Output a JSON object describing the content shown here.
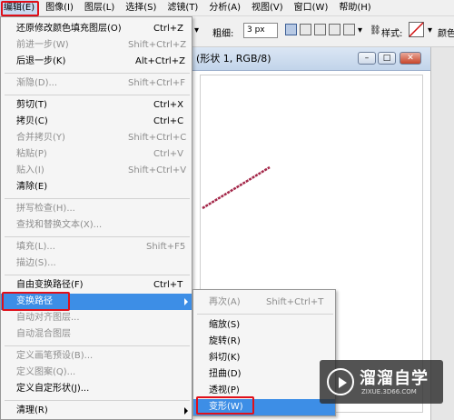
{
  "menubar": {
    "items": [
      "编辑(E)",
      "图像(I)",
      "图层(L)",
      "选择(S)",
      "滤镜(T)",
      "分析(A)",
      "视图(V)",
      "窗口(W)",
      "帮助(H)"
    ]
  },
  "options_bar": {
    "weight_label": "粗细:",
    "weight_value": "3 px",
    "style_label": "样式:",
    "color_label": "颜色:"
  },
  "document": {
    "title": "(形状 1, RGB/8)"
  },
  "edit_menu": {
    "items": [
      {
        "label": "还原修改颜色填充图层(O)",
        "shortcut": "Ctrl+Z",
        "disabled": false
      },
      {
        "label": "前进一步(W)",
        "shortcut": "Shift+Ctrl+Z",
        "disabled": true
      },
      {
        "label": "后退一步(K)",
        "shortcut": "Alt+Ctrl+Z",
        "disabled": false
      },
      {
        "label": "渐隐(D)...",
        "shortcut": "Shift+Ctrl+F",
        "disabled": true
      },
      {
        "label": "剪切(T)",
        "shortcut": "Ctrl+X",
        "disabled": false
      },
      {
        "label": "拷贝(C)",
        "shortcut": "Ctrl+C",
        "disabled": false
      },
      {
        "label": "合并拷贝(Y)",
        "shortcut": "Shift+Ctrl+C",
        "disabled": true
      },
      {
        "label": "粘贴(P)",
        "shortcut": "Ctrl+V",
        "disabled": true
      },
      {
        "label": "贴入(I)",
        "shortcut": "Shift+Ctrl+V",
        "disabled": true
      },
      {
        "label": "清除(E)",
        "shortcut": "",
        "disabled": false
      },
      {
        "label": "拼写检查(H)...",
        "shortcut": "",
        "disabled": true
      },
      {
        "label": "查找和替换文本(X)...",
        "shortcut": "",
        "disabled": true
      },
      {
        "label": "填充(L)...",
        "shortcut": "Shift+F5",
        "disabled": true
      },
      {
        "label": "描边(S)...",
        "shortcut": "",
        "disabled": true
      },
      {
        "label": "自由变换路径(F)",
        "shortcut": "Ctrl+T",
        "disabled": false
      },
      {
        "label": "变换路径",
        "shortcut": "",
        "disabled": false
      },
      {
        "label": "自动对齐图层...",
        "shortcut": "",
        "disabled": true
      },
      {
        "label": "自动混合图层",
        "shortcut": "",
        "disabled": true
      },
      {
        "label": "定义画笔预设(B)...",
        "shortcut": "",
        "disabled": true
      },
      {
        "label": "定义图案(Q)...",
        "shortcut": "",
        "disabled": true
      },
      {
        "label": "定义自定形状(J)...",
        "shortcut": "",
        "disabled": false
      },
      {
        "label": "清理(R)",
        "shortcut": "",
        "disabled": false
      }
    ]
  },
  "transform_submenu": {
    "items": [
      {
        "label": "再次(A)",
        "shortcut": "Shift+Ctrl+T",
        "disabled": true
      },
      {
        "label": "缩放(S)",
        "shortcut": "",
        "disabled": false
      },
      {
        "label": "旋转(R)",
        "shortcut": "",
        "disabled": false
      },
      {
        "label": "斜切(K)",
        "shortcut": "",
        "disabled": false
      },
      {
        "label": "扭曲(D)",
        "shortcut": "",
        "disabled": false
      },
      {
        "label": "透视(P)",
        "shortcut": "",
        "disabled": false
      },
      {
        "label": "变形(W)",
        "shortcut": "",
        "disabled": false
      }
    ]
  },
  "watermark": {
    "brand": "溜溜自学",
    "url": "ZIXUE.3D66.COM"
  },
  "colors": {
    "highlight": "#3d8ee6",
    "annotation_red": "#e0101a",
    "path_stroke": "#a4284a"
  }
}
